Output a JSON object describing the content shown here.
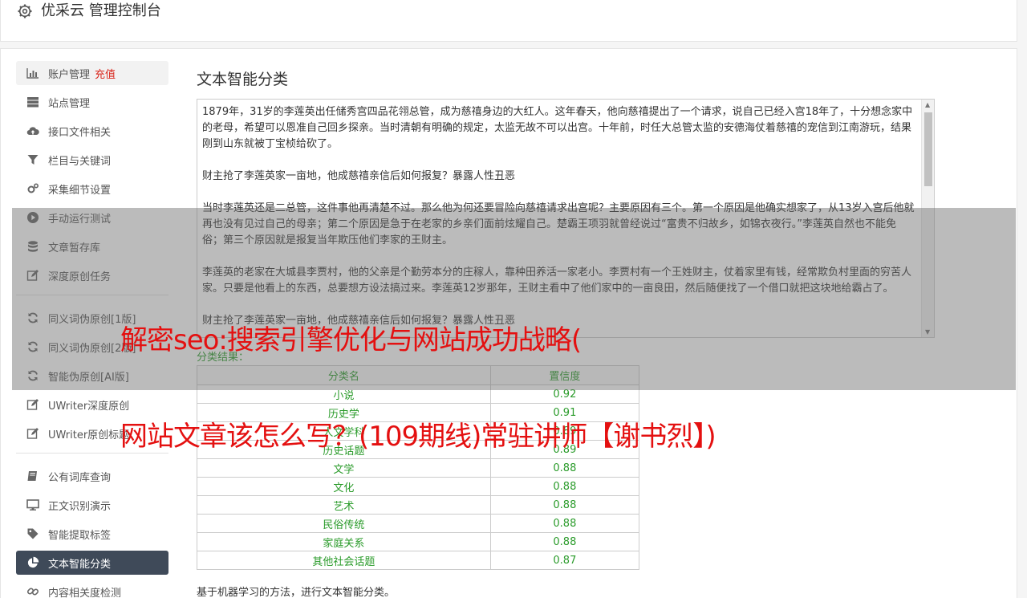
{
  "header": {
    "title": "优采云 管理控制台"
  },
  "sidebar": {
    "items": [
      {
        "label": "账户管理",
        "icon": "bar-chart-icon",
        "badge": "充值"
      },
      {
        "label": "站点管理",
        "icon": "server-icon"
      },
      {
        "label": "接口文件相关",
        "icon": "cloud-upload-icon"
      },
      {
        "label": "栏目与关键词",
        "icon": "filter-icon"
      },
      {
        "label": "采集细节设置",
        "icon": "gears-icon"
      },
      {
        "label": "手动运行测试",
        "icon": "play-circle-icon"
      },
      {
        "label": "文章暂存库",
        "icon": "database-icon"
      },
      {
        "label": "深度原创任务",
        "icon": "edit-icon"
      },
      {
        "label": "同义词伪原创[1版]",
        "icon": "refresh-icon"
      },
      {
        "label": "同义词伪原创[2版]",
        "icon": "refresh-icon"
      },
      {
        "label": "智能伪原创[AI版]",
        "icon": "refresh-icon"
      },
      {
        "label": "UWriter深度原创",
        "icon": "edit-icon"
      },
      {
        "label": "UWriter原创标题",
        "icon": "edit-icon"
      },
      {
        "label": "公有词库查询",
        "icon": "book-icon"
      },
      {
        "label": "正文识别演示",
        "icon": "desktop-icon"
      },
      {
        "label": "智能提取标签",
        "icon": "tag-icon"
      },
      {
        "label": "文本智能分类",
        "icon": "pie-chart-icon"
      },
      {
        "label": "内容相关度检测",
        "icon": "link-icon"
      }
    ]
  },
  "main": {
    "title": "文本智能分类",
    "input_paragraphs": [
      "1879年，31岁的李莲英出任储秀宫四品花翎总管，成为慈禧身边的大红人。这年春天，他向慈禧提出了一个请求，说自己已经入宫18年了，十分想念家中的老母，希望可以恩准自己回乡探亲。当时清朝有明确的规定，太监无故不可以出宫。十年前，时任大总管太监的安德海仗着慈禧的宠信到江南游玩，结果刚到山东就被丁宝桢给砍了。",
      "财主抢了李莲英家一亩地，他成慈禧亲信后如何报复？暴露人性丑恶",
      "当时李莲英还是二总管，这件事他再清楚不过。那么他为何还要冒险向慈禧请求出宫呢？主要原因有三个。第一个原因是他确实想家了，从13岁入宫后他就再也没有见过自己的母亲；第二个原因是急于在老家的乡亲们面前炫耀自己。楚霸王项羽就曾经说过“富贵不归故乡，如锦衣夜行。”李莲英自然也不能免俗；第三个原因就是报复当年欺压他们李家的王财主。",
      "李莲英的老家在大城县李贾村，他的父亲是个勤劳本分的庄稼人，靠种田养活一家老小。李贾村有一个王姓财主，仗着家里有钱，经常欺负村里面的穷苦人家。只要是他看上的东西，总要想方设法搞过来。李莲英12岁那年，王财主看中了他们家中的一亩良田，然后随便找了一个借口就把这块地给霸占了。",
      "财主抢了李莲英家一亩地，他成慈禧亲信后如何报复？暴露人性丑恶"
    ],
    "result_label": "分类结果：",
    "table": {
      "headers": [
        "分类名",
        "置信度"
      ],
      "rows": [
        [
          "小说",
          "0.92"
        ],
        [
          "历史学",
          "0.91"
        ],
        [
          "人文学科",
          "0.89"
        ],
        [
          "历史话题",
          "0.89"
        ],
        [
          "文学",
          "0.88"
        ],
        [
          "文化",
          "0.88"
        ],
        [
          "艺术",
          "0.88"
        ],
        [
          "民俗传统",
          "0.88"
        ],
        [
          "家庭关系",
          "0.88"
        ],
        [
          "其他社会话题",
          "0.87"
        ]
      ]
    },
    "footer": "基于机器学习的方法，进行文本智能分类。"
  },
  "watermark": {
    "line1": "解密seo:搜索引擎优化与网站成功战略(",
    "line2": "网站文章该怎么写？(109期线)常驻讲师【谢书烈】)"
  },
  "colors": {
    "active_bg": "#3f4a59",
    "result_green": "#2a9b2a",
    "watermark_red": "#e41010",
    "recharge_red": "#d9261c"
  }
}
